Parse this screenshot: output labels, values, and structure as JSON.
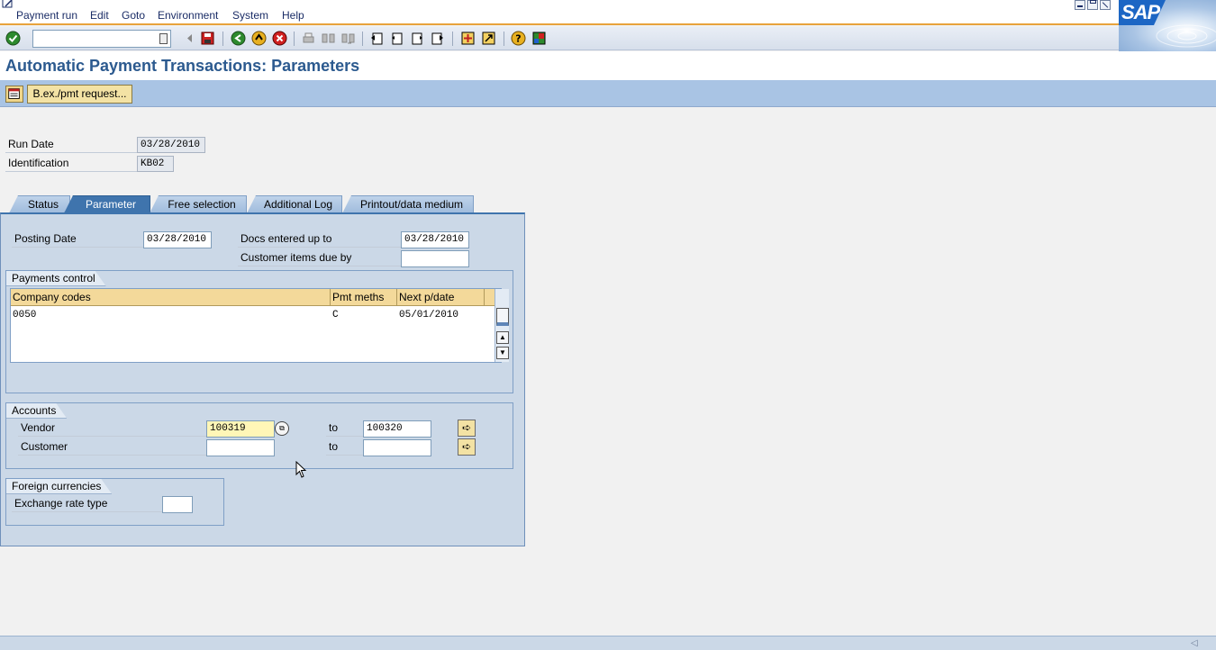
{
  "menu": [
    "Payment run",
    "Edit",
    "Goto",
    "Environment",
    "System",
    "Help"
  ],
  "logo_text": "SAP",
  "toolbar": {
    "command_value": "",
    "icons": [
      "enter-icon",
      "back-arrow-icon",
      "save-icon",
      "back-icon",
      "exit-icon",
      "cancel-icon",
      "print-icon",
      "find-icon",
      "find-next-icon",
      "first-page-icon",
      "prev-page-icon",
      "next-page-icon",
      "last-page-icon",
      "create-session-icon",
      "shortcut-icon",
      "help-icon",
      "layout-icon"
    ]
  },
  "title": "Automatic Payment Transactions: Parameters",
  "app_toolbar": {
    "bex_label": "B.ex./pmt request..."
  },
  "header": {
    "run_date_label": "Run Date",
    "run_date_value": "03/28/2010",
    "identification_label": "Identification",
    "identification_value": "KB02"
  },
  "tabs": [
    "Status",
    "Parameter",
    "Free selection",
    "Additional Log",
    "Printout/data medium"
  ],
  "active_tab": "Parameter",
  "parameter": {
    "posting_date_label": "Posting Date",
    "posting_date_value": "03/28/2010",
    "docs_entered_label": "Docs entered up to",
    "docs_entered_value": "03/28/2010",
    "customer_due_label": "Customer items due by",
    "customer_due_value": ""
  },
  "payments_control": {
    "title": "Payments control",
    "columns": [
      "Company codes",
      "Pmt meths",
      "Next p/date"
    ],
    "rows": [
      [
        "0050",
        "C",
        "05/01/2010"
      ]
    ]
  },
  "accounts": {
    "title": "Accounts",
    "vendor_label": "Vendor",
    "vendor_from": "100319",
    "vendor_to_label": "to",
    "vendor_to": "100320",
    "customer_label": "Customer",
    "customer_from": "",
    "customer_to_label": "to",
    "customer_to": ""
  },
  "foreign_currencies": {
    "title": "Foreign currencies",
    "exchange_rate_label": "Exchange rate type",
    "exchange_rate_value": ""
  },
  "colors": {
    "title": "#2c5a8f",
    "tab_active": "#3f74ad",
    "panel": "#cbd8e7",
    "app_toolbar": "#a9c4e4",
    "required_field": "#fff6b7"
  }
}
